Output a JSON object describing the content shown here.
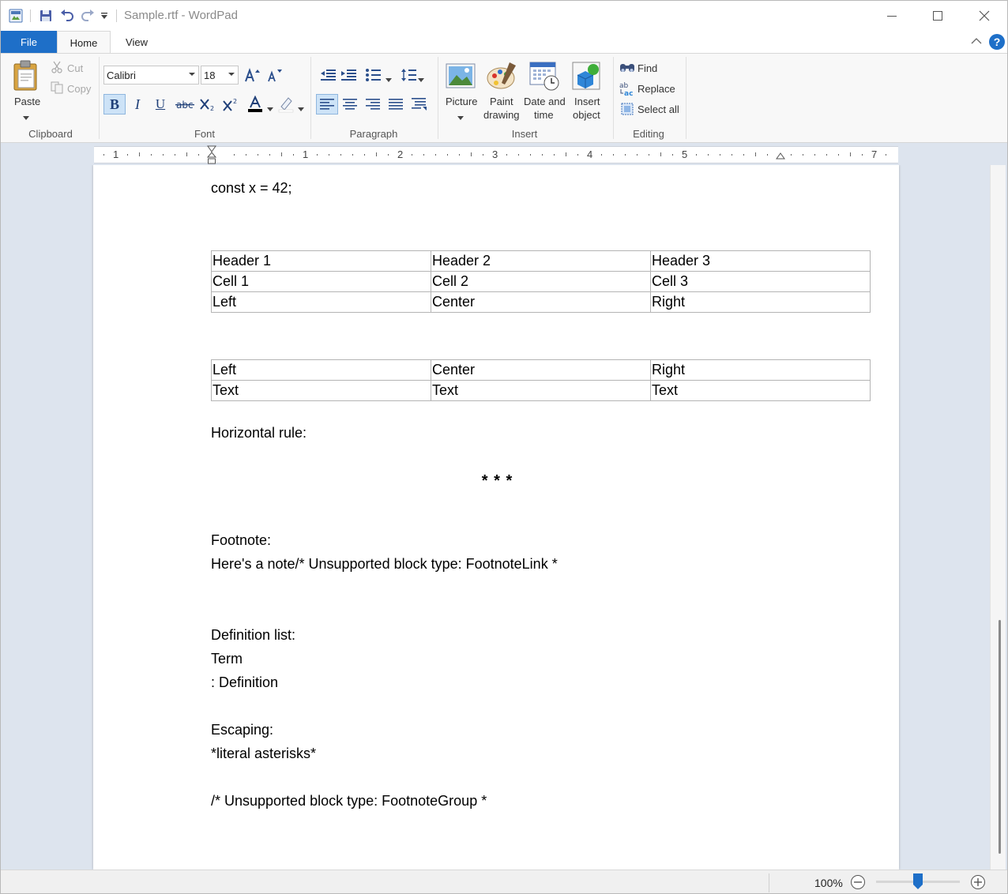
{
  "window": {
    "title": "Sample.rtf - WordPad"
  },
  "tabs": {
    "file": "File",
    "home": "Home",
    "view": "View"
  },
  "ribbon": {
    "clipboard": {
      "paste": "Paste",
      "cut": "Cut",
      "copy": "Copy",
      "label": "Clipboard"
    },
    "font": {
      "family": "Calibri",
      "size": "18",
      "label": "Font"
    },
    "paragraph": {
      "label": "Paragraph"
    },
    "insert": {
      "picture": "Picture",
      "paint_1": "Paint",
      "paint_2": "drawing",
      "date_1": "Date and",
      "date_2": "time",
      "object_1": "Insert",
      "object_2": "object",
      "label": "Insert"
    },
    "editing": {
      "find": "Find",
      "replace": "Replace",
      "select_all": "Select all",
      "label": "Editing"
    }
  },
  "ruler": {
    "numbers": [
      "1",
      "1",
      "2",
      "3",
      "4",
      "5",
      "7"
    ]
  },
  "document": {
    "code_line": "const x = 42;",
    "table1": [
      [
        "Header 1",
        "Header 2",
        "Header 3"
      ],
      [
        "Cell 1",
        "Cell 2",
        "Cell 3"
      ],
      [
        "Left",
        "Center",
        "Right"
      ]
    ],
    "table2": [
      [
        "Left",
        "Center",
        "Right"
      ],
      [
        "Text",
        "Text",
        "Text"
      ]
    ],
    "hr_label": "Horizontal rule:",
    "hr_mark": "* * *",
    "footnote_label": "Footnote:",
    "footnote_text": "Here's a note/* Unsupported block type: FootnoteLink *",
    "deflist_label": "Definition list:",
    "term": "Term",
    "definition": ": Definition",
    "escaping_label": "Escaping:",
    "escaping_text": "*literal asterisks*",
    "footnote_group": "/* Unsupported block type: FootnoteGroup *"
  },
  "status": {
    "zoom": "100%",
    "zoom_level_fraction": 0.5
  },
  "colors": {
    "accent": "#1e6fc8",
    "workspace": "#dde4ee",
    "font_color_bar": "#000000"
  }
}
